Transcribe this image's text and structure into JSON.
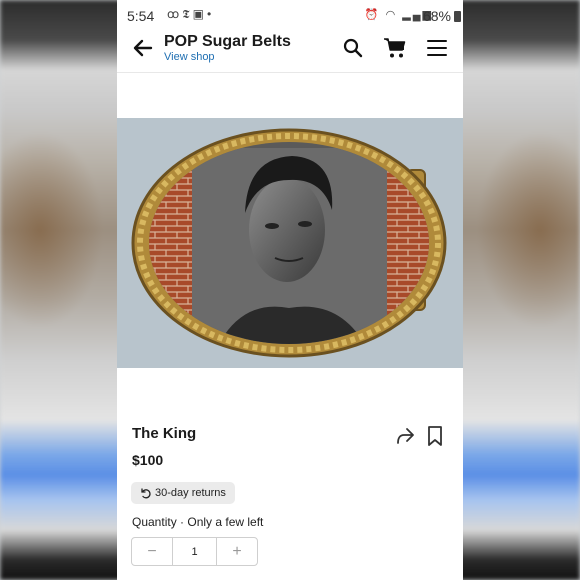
{
  "status_bar": {
    "time": "5:54",
    "left_icons": [
      "voicemail-icon",
      "nytimes-icon",
      "gallery-icon",
      "dot-icon"
    ],
    "battery_pct": "68%"
  },
  "app_bar": {
    "shop_title": "POP Sugar Belts",
    "view_shop_label": "View shop"
  },
  "product": {
    "title": "The King",
    "price": "$100",
    "returns_badge": "30-day returns",
    "quantity_label": "Quantity · Only a few left",
    "quantity_value": "1",
    "minus_label": "−",
    "plus_label": "+"
  },
  "colors": {
    "link": "#1f6fb2",
    "brass": "#b08a3a",
    "badge_bg": "#ebebeb"
  }
}
